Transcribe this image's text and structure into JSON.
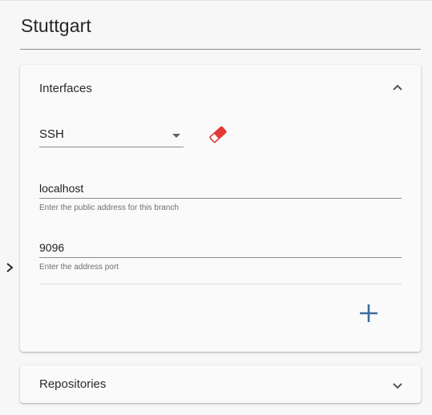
{
  "page": {
    "title": "Stuttgart"
  },
  "interfaces_panel": {
    "title": "Interfaces",
    "expanded": true,
    "expand_icon": "chevron-up-icon",
    "protocol_select": {
      "value": "SSH",
      "icon": "dropdown-caret-icon"
    },
    "remove_icon": "eraser-icon",
    "address_field": {
      "value": "localhost",
      "hint": "Enter the public address for this branch"
    },
    "port_field": {
      "value": "9096",
      "hint": "Enter the address port"
    },
    "add_icon": "plus-icon"
  },
  "repositories_panel": {
    "title": "Repositories",
    "expanded": false,
    "expand_icon": "chevron-down-icon"
  },
  "side_toggle": {
    "icon": "chevron-right-icon"
  },
  "colors": {
    "eraser": "#e53935",
    "add_button": "#3f6a9f",
    "text": "#212121",
    "hint": "#6f6f6f",
    "background": "#f7f7f7",
    "panel": "#fafafa"
  }
}
